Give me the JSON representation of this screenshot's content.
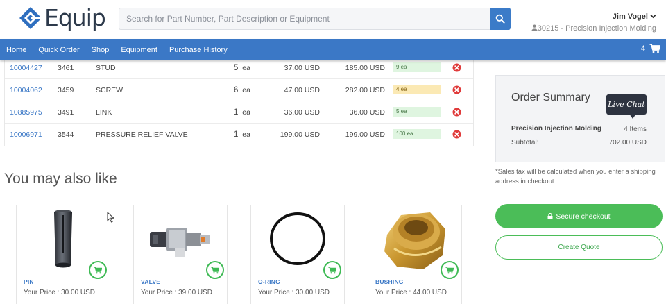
{
  "brand": {
    "name": "Equip"
  },
  "search": {
    "placeholder": "Search for Part Number, Part Description or Equipment"
  },
  "user": {
    "name": "Jim Vogel",
    "account": "30215 - Precision Injection Molding"
  },
  "nav": {
    "items": [
      "Home",
      "Quick Order",
      "Shop",
      "Equipment",
      "Purchase History"
    ]
  },
  "cart": {
    "count": "4"
  },
  "cart_rows": [
    {
      "part": "10004427",
      "num": "3461",
      "desc": "STUD",
      "qty": "5",
      "unit_label": "ea",
      "unit_price": "37.00 USD",
      "total": "185.00 USD",
      "stock": "9 ea",
      "stock_color": "green"
    },
    {
      "part": "10004062",
      "num": "3459",
      "desc": "SCREW",
      "qty": "6",
      "unit_label": "ea",
      "unit_price": "47.00 USD",
      "total": "282.00 USD",
      "stock": "4 ea",
      "stock_color": "yellow"
    },
    {
      "part": "10885975",
      "num": "3491",
      "desc": "LINK",
      "qty": "1",
      "unit_label": "ea",
      "unit_price": "36.00 USD",
      "total": "36.00 USD",
      "stock": "5 ea",
      "stock_color": "green"
    },
    {
      "part": "10006971",
      "num": "3544",
      "desc": "PRESSURE RELIEF VALVE",
      "qty": "1",
      "unit_label": "ea",
      "unit_price": "199.00 USD",
      "total": "199.00 USD",
      "stock": "100 ea",
      "stock_color": "green"
    }
  ],
  "recommend": {
    "title": "You may also like",
    "items": [
      {
        "name": "PIN",
        "price": "Your Price : 30.00 USD"
      },
      {
        "name": "VALVE",
        "price": "Your Price : 39.00 USD"
      },
      {
        "name": "O-RING",
        "price": "Your Price : 30.00 USD"
      },
      {
        "name": "BUSHING",
        "price": "Your Price : 44.00 USD"
      }
    ]
  },
  "summary": {
    "title": "Order Summary",
    "company": "Precision Injection Molding",
    "items": "4 Items",
    "subtotal_label": "Subtotal:",
    "subtotal": "702.00 USD",
    "live_chat": "Live Chat",
    "tax_note": "*Sales tax will be calculated when you enter a shipping address in checkout.",
    "checkout_label": "Secure checkout",
    "quote_label": "Create Quote"
  },
  "colors": {
    "nav": "#3b78c6",
    "accent_green": "#4bbd58",
    "link": "#3b78c6"
  }
}
